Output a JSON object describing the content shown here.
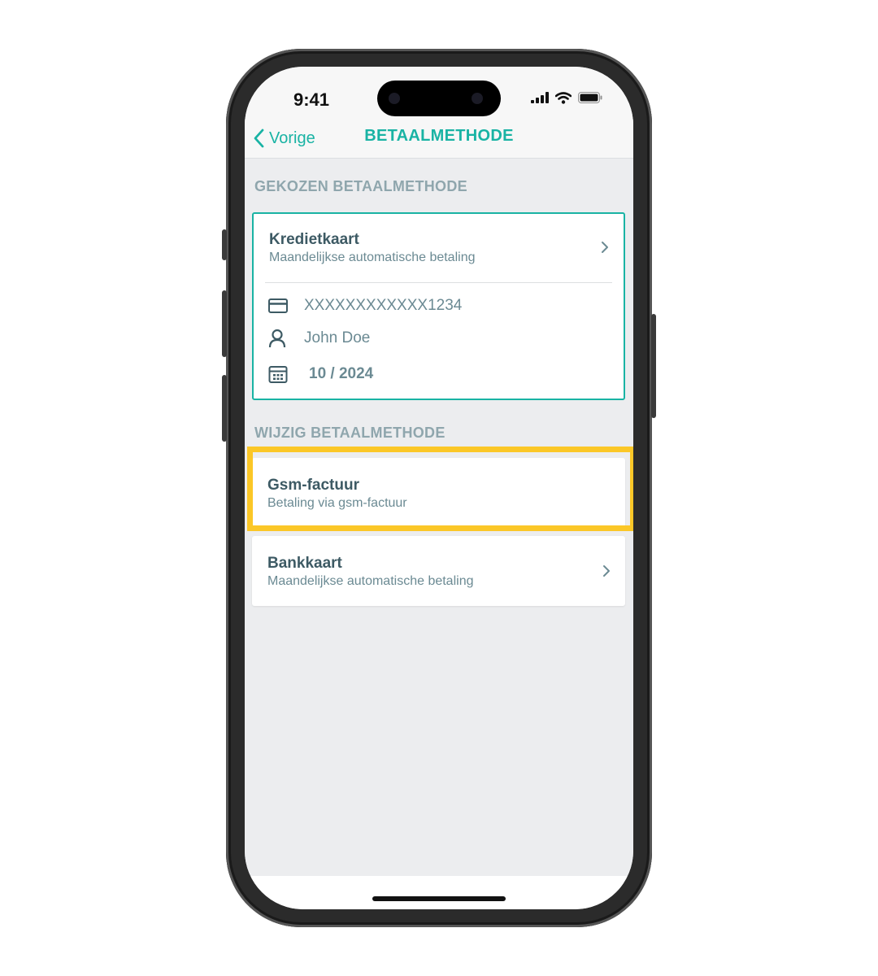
{
  "status_bar": {
    "time": "9:41"
  },
  "nav": {
    "back_label": "Vorige",
    "title": "BETAALMETHODE"
  },
  "current_section": {
    "title": "GEKOZEN BETAALMETHODE",
    "method": {
      "title": "Kredietkaart",
      "subtitle": "Maandelijkse automatische betaling",
      "card_number": "XXXXXXXXXXXX1234",
      "holder": "John Doe",
      "expiry": "10 / 2024"
    }
  },
  "change_section": {
    "title": "WIJZIG BETAALMETHODE",
    "options": [
      {
        "title": "Gsm-factuur",
        "subtitle": "Betaling via gsm-factuur",
        "highlighted": true
      },
      {
        "title": "Bankkaart",
        "subtitle": "Maandelijkse automatische betaling",
        "highlighted": false
      }
    ]
  },
  "colors": {
    "accent": "#19b3a4",
    "highlight": "#fbc727",
    "text_primary": "#3d5a64",
    "text_secondary": "#6b8a93",
    "section_title": "#8fa6ad",
    "background": "#ecedef"
  }
}
